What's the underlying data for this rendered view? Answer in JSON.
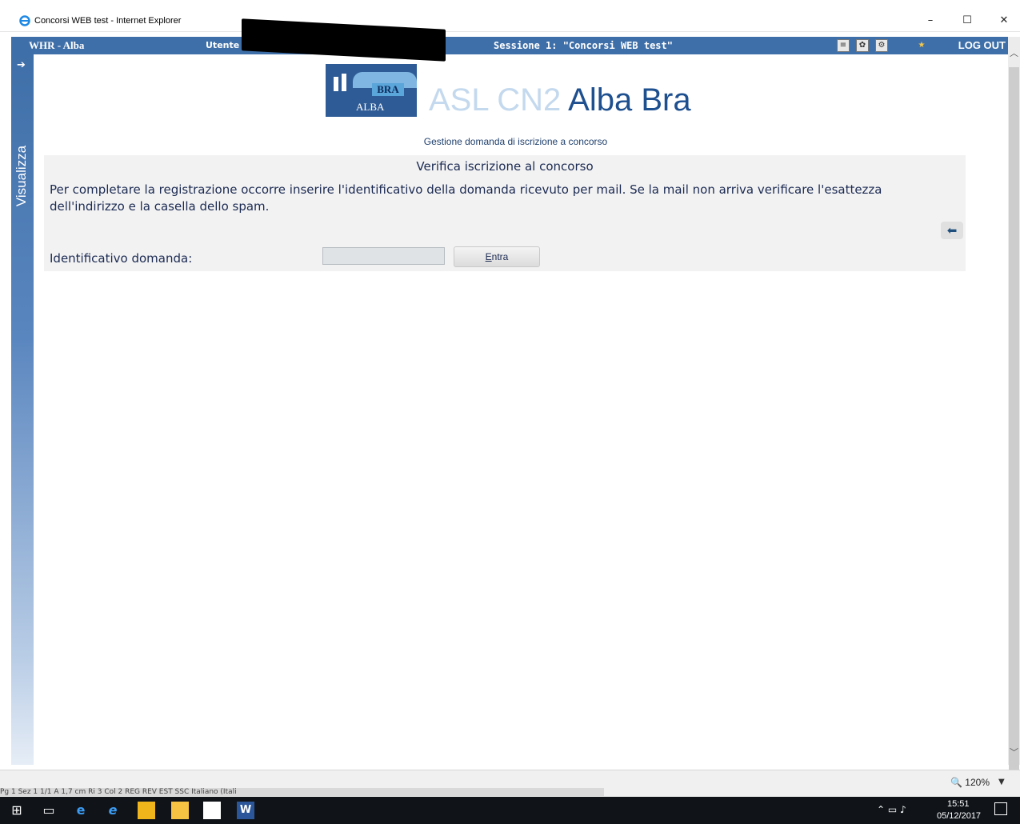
{
  "window": {
    "title": "Concorsi WEB test - Internet Explorer",
    "minimize": "–",
    "maximize": "☐",
    "close": "✕"
  },
  "header": {
    "app_name": "WHR - Alba",
    "user_label": "Utente scelto",
    "session": "Sessione 1: \"Concorsi WEB test\"",
    "logout": "LOG OUT"
  },
  "sidebar": {
    "label": "Visualizza"
  },
  "logo": {
    "bra": "BRA",
    "alba": "ALBA",
    "asl": "ASL CN2",
    "city": "Alba Bra"
  },
  "page": {
    "subtitle": "Gestione domanda di iscrizione a concorso",
    "form_title": "Verifica iscrizione al concorso",
    "description": "Per completare la registrazione occorre inserire l'identificativo della domanda ricevuto per mail. Se la mail non arriva verificare l'esattezza dell'indirizzo e la casella dello spam.",
    "field_label": "Identificativo domanda:",
    "field_value": "",
    "button_label_first": "E",
    "button_label_rest": "ntra"
  },
  "statusbar": {
    "zoom": "120%",
    "word_status": "Pg 1    Sez 1    1/1    A 1,7 cm    Ri 3    Col 2    REG  REV  EST  SSC   Italiano (Itali"
  },
  "taskbar": {
    "time": "15:51",
    "date": "05/12/2017"
  },
  "icons": [
    "ie-icon",
    "document-icon",
    "users-icon",
    "settings-icon",
    "star-icon",
    "back-arrow-icon",
    "windows-start-icon",
    "task-view-icon",
    "edge-icon",
    "ie-taskbar-icon",
    "outlook-icon",
    "file-explorer-icon",
    "notepad-icon",
    "word-icon"
  ]
}
